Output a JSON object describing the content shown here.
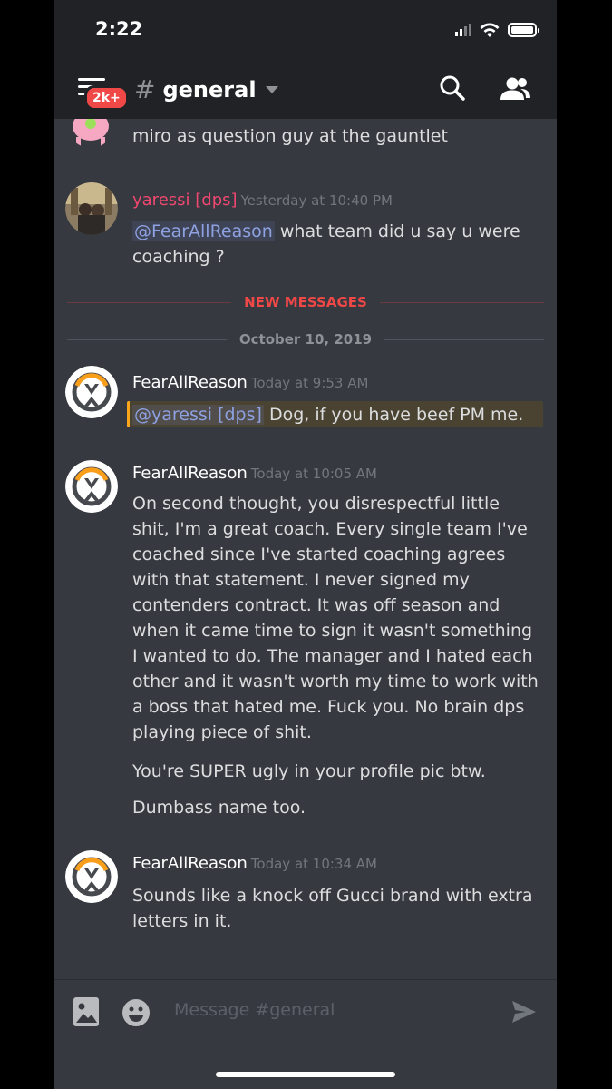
{
  "status_bar": {
    "time": "2:22"
  },
  "header": {
    "badge": "2k+",
    "hash": "#",
    "channel": "general"
  },
  "messages": [
    {
      "author": "",
      "timestamp": "",
      "body": "miro as question guy at the gauntlet"
    },
    {
      "author": "yaressi [dps]",
      "author_color": "#f04770",
      "timestamp": "Yesterday at 10:40 PM",
      "mention": "@FearAllReason",
      "body": " what team did u say u were coaching ?"
    },
    {
      "author": "FearAllReason",
      "timestamp": "Today at 9:53 AM",
      "mention": "@yaressi [dps]",
      "body": " Dog, if you have beef PM me."
    },
    {
      "author": "FearAllReason",
      "timestamp": "Today at 10:05 AM",
      "body": "On second thought, you disrespectful little shit, I'm a great coach. Every single team I've coached since I've started coaching agrees with that statement. I never signed my contenders contract. It was off season and when it came time to sign it wasn't something I wanted to do. The manager and I hated each other and it wasn't worth my time to work with a boss that hated me. Fuck you. No brain dps playing piece of shit.",
      "body2": "You're SUPER ugly in your profile pic btw.",
      "body3": "Dumbass name too."
    },
    {
      "author": "FearAllReason",
      "timestamp": "Today at 10:34 AM",
      "body": "Sounds like a knock off Gucci brand with extra letters in it."
    }
  ],
  "dividers": {
    "new_messages": "NEW MESSAGES",
    "date": "October 10, 2019"
  },
  "composer": {
    "placeholder": "Message #general"
  },
  "colors": {
    "background": "#36393f",
    "header": "#202225",
    "mention": "#8ea1e1",
    "new_messages": "#f04747"
  }
}
